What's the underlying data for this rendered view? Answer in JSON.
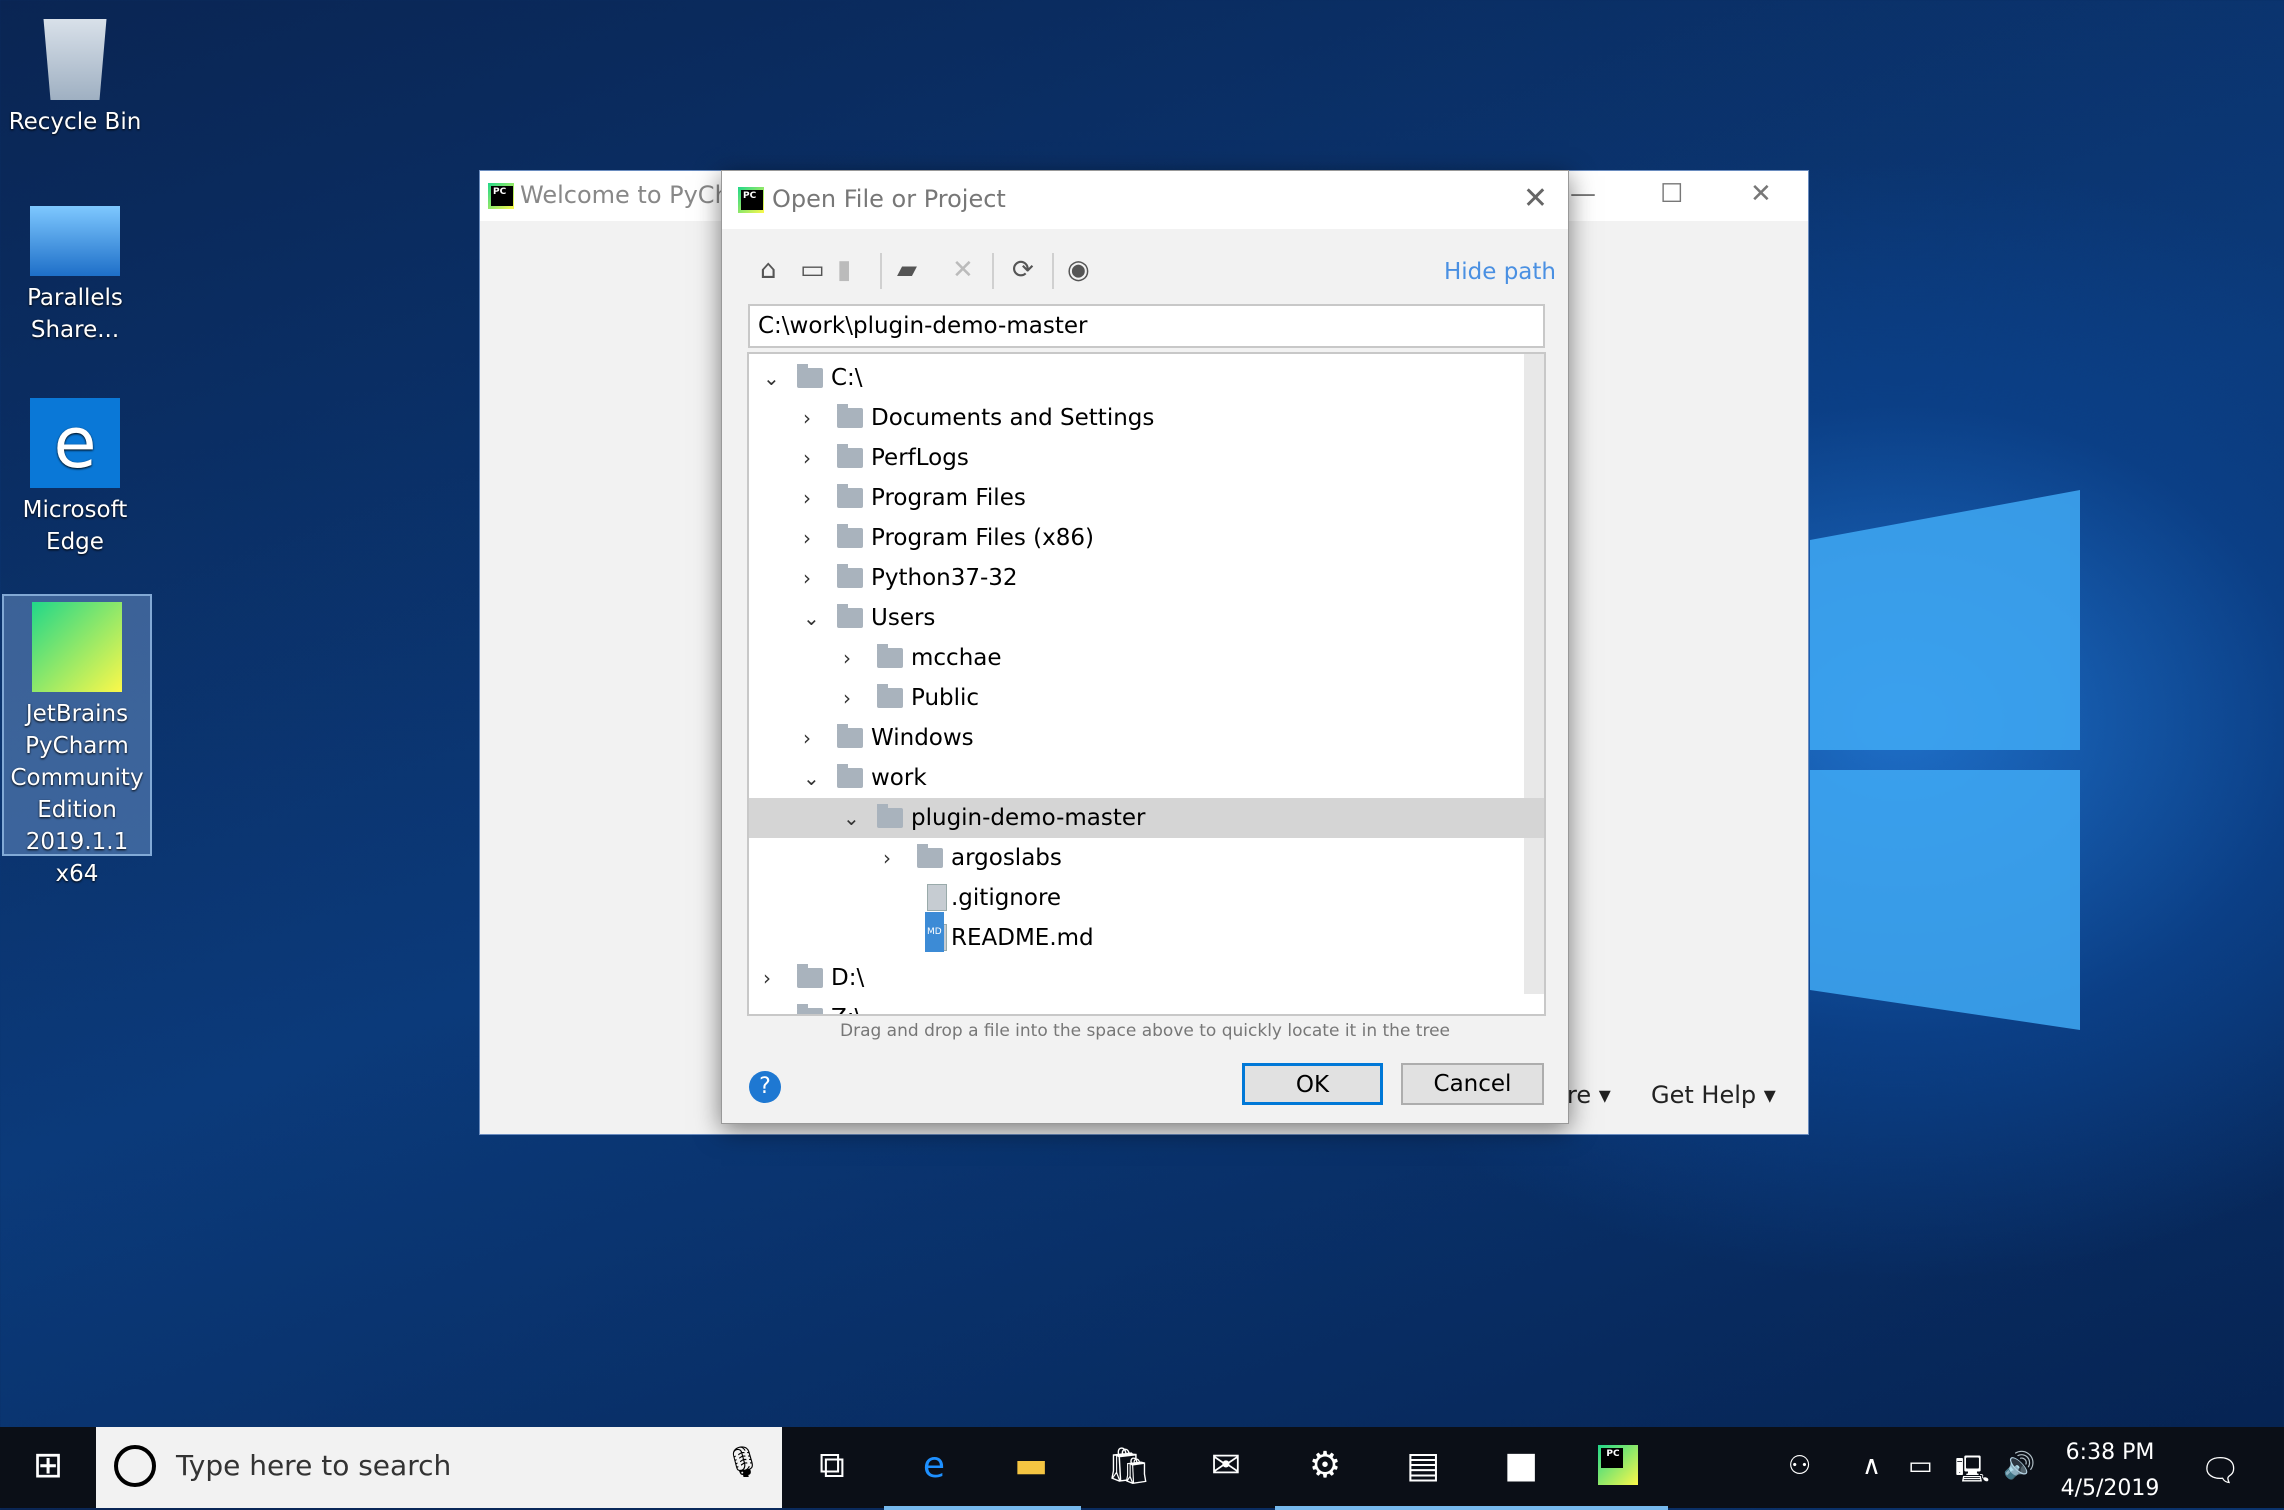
{
  "desktop": {
    "icons": [
      {
        "label": "Recycle Bin"
      },
      {
        "label": "Parallels Share..."
      },
      {
        "label": "Microsoft Edge"
      },
      {
        "label": "JetBrains PyCharm Community Edition 2019.1.1 x64"
      }
    ]
  },
  "welcome": {
    "title": "Welcome to PyCha",
    "menu_configure": "re",
    "menu_help": "Get Help"
  },
  "dialog": {
    "title": "Open File or Project",
    "hide_path": "Hide path",
    "path": "C:\\work\\plugin-demo-master",
    "toolbar": [
      "home-icon",
      "desktop-icon",
      "project-folder-icon",
      "new-folder-icon",
      "delete-icon",
      "refresh-icon",
      "show-hidden-icon"
    ],
    "tree": [
      {
        "label": "C:\\",
        "level": 0,
        "state": "open",
        "type": "drive"
      },
      {
        "label": "Documents and Settings",
        "level": 1,
        "state": "closed",
        "type": "folder"
      },
      {
        "label": "PerfLogs",
        "level": 1,
        "state": "closed",
        "type": "folder"
      },
      {
        "label": "Program Files",
        "level": 1,
        "state": "closed",
        "type": "folder"
      },
      {
        "label": "Program Files (x86)",
        "level": 1,
        "state": "closed",
        "type": "folder"
      },
      {
        "label": "Python37-32",
        "level": 1,
        "state": "closed",
        "type": "folder"
      },
      {
        "label": "Users",
        "level": 1,
        "state": "open",
        "type": "folder"
      },
      {
        "label": "mcchae",
        "level": 2,
        "state": "closed",
        "type": "folder"
      },
      {
        "label": "Public",
        "level": 2,
        "state": "closed",
        "type": "folder"
      },
      {
        "label": "Windows",
        "level": 1,
        "state": "closed",
        "type": "folder"
      },
      {
        "label": "work",
        "level": 1,
        "state": "open",
        "type": "folder"
      },
      {
        "label": "plugin-demo-master",
        "level": 2,
        "state": "open",
        "type": "folder",
        "selected": true
      },
      {
        "label": "argoslabs",
        "level": 3,
        "state": "closed",
        "type": "folder"
      },
      {
        "label": ".gitignore",
        "level": 3,
        "state": "none",
        "type": "file"
      },
      {
        "label": "README.md",
        "level": 3,
        "state": "none",
        "type": "md"
      },
      {
        "label": "D:\\",
        "level": 0,
        "state": "closed",
        "type": "drive"
      },
      {
        "label": "Z:\\",
        "level": 0,
        "state": "closed",
        "type": "drive"
      }
    ],
    "hint": "Drag and drop a file into the space above to quickly locate it in the tree",
    "ok": "OK",
    "cancel": "Cancel"
  },
  "taskbar": {
    "search_placeholder": "Type here to search",
    "time": "6:38 PM",
    "date": "4/5/2019",
    "apps": [
      "task-view",
      "edge",
      "file-explorer",
      "store",
      "mail",
      "settings",
      "control-panel",
      "cmd",
      "pycharm"
    ]
  },
  "colors": {
    "accent": "#0078d7",
    "link": "#4a90e2"
  }
}
